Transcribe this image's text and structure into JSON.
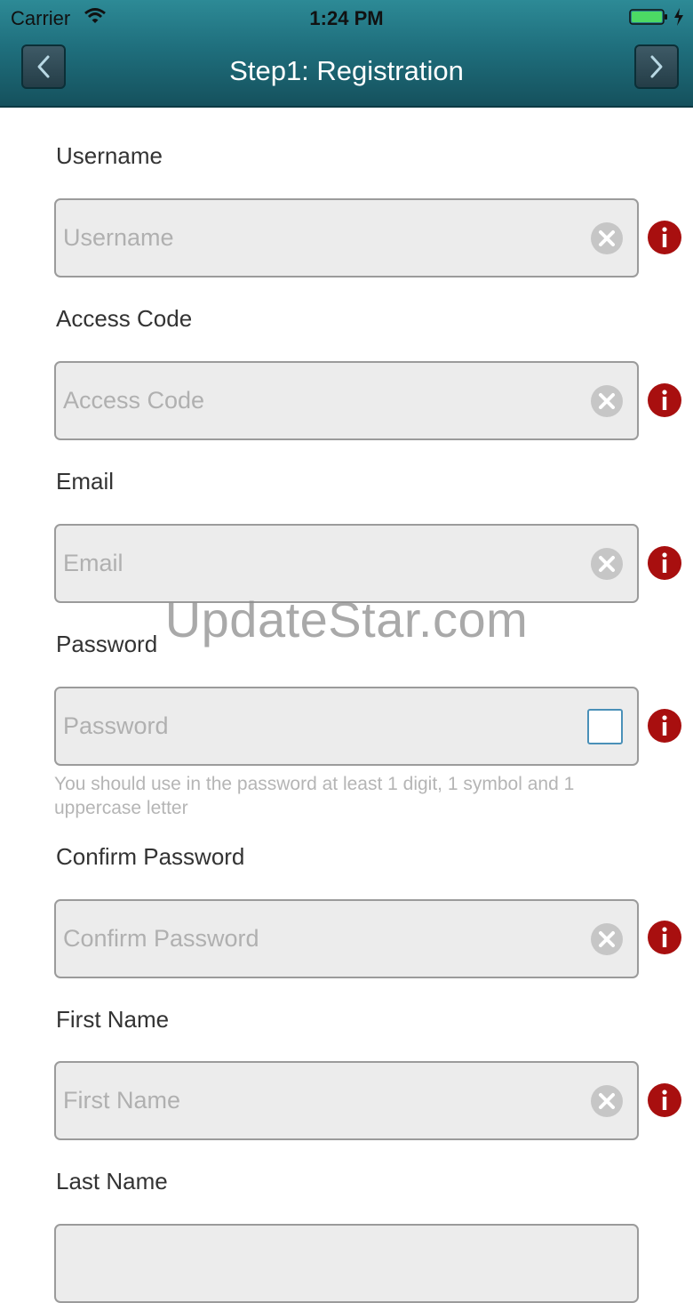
{
  "status_bar": {
    "carrier": "Carrier",
    "time": "1:24 PM"
  },
  "nav": {
    "title": "Step1: Registration",
    "back_icon": "chevron-left-icon",
    "next_icon": "chevron-right-icon"
  },
  "fields": [
    {
      "label": "Username",
      "placeholder": "Username",
      "action": "clear"
    },
    {
      "label": "Access Code",
      "placeholder": "Access Code",
      "action": "clear"
    },
    {
      "label": "Email",
      "placeholder": "Email",
      "action": "clear"
    },
    {
      "label": "Password",
      "placeholder": "Password",
      "action": "checkbox",
      "hint": "You should use in the password at least 1 digit, 1 symbol and 1 uppercase letter"
    },
    {
      "label": "Confirm Password",
      "placeholder": "Confirm Password",
      "action": "clear"
    },
    {
      "label": "First Name",
      "placeholder": "First Name",
      "action": "clear"
    },
    {
      "label": "Last Name",
      "placeholder": "",
      "action": ""
    }
  ],
  "watermark": "UpdateStar.com",
  "colors": {
    "header": "#1f6f7d",
    "info": "#a80f0f",
    "field_bg": "#ececec"
  }
}
